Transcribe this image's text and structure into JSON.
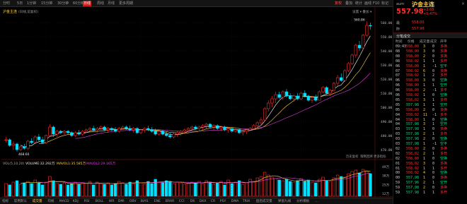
{
  "toolbar": {
    "periods": [
      "分时",
      "5日",
      "1分钟",
      "15分钟",
      "30分钟",
      "60分钟",
      "日线",
      "周线",
      "月线",
      "更多周期"
    ],
    "active_period": "日线",
    "right_items": [
      "复权",
      "叠加",
      "统计",
      "画线",
      "F10",
      "标记",
      "-",
      "⊡"
    ]
  },
  "chart_header": {
    "symbol": "沪金主连",
    "info": "(日线,前复权)",
    "setting": "设置 ▾ 叠加 ▾"
  },
  "chart_data": {
    "type": "candlestick",
    "ylim": [
      465,
      565
    ],
    "y_ticks": [
      560,
      550,
      540,
      530,
      520,
      510,
      500,
      490,
      480,
      470
    ],
    "x_labels": [
      {
        "i": 11,
        "label": "12"
      },
      {
        "i": 37,
        "label": "2024"
      },
      {
        "i": 62,
        "label": "02"
      },
      {
        "i": 81,
        "label": "03"
      },
      {
        "i": 102,
        "label": "04"
      }
    ],
    "high_label": "560.86",
    "low_label": "468.60",
    "ohlc": [
      [
        477,
        479,
        475,
        477
      ],
      [
        477,
        478,
        472,
        473
      ],
      [
        473,
        476,
        470,
        474
      ],
      [
        474,
        475,
        468.6,
        470
      ],
      [
        470,
        473,
        469,
        472
      ],
      [
        472,
        474,
        470,
        471
      ],
      [
        471,
        477,
        470,
        476
      ],
      [
        476,
        478,
        474,
        475
      ],
      [
        475,
        480,
        474,
        479
      ],
      [
        479,
        481,
        476,
        477
      ],
      [
        477,
        479,
        474,
        475
      ],
      [
        475,
        481,
        474,
        480
      ],
      [
        480,
        488,
        479,
        486
      ],
      [
        486,
        487,
        479,
        481
      ],
      [
        481,
        484,
        479,
        483
      ],
      [
        483,
        484,
        481,
        482
      ],
      [
        482,
        484,
        480,
        483
      ],
      [
        483,
        484,
        481,
        482
      ],
      [
        482,
        483,
        479,
        480
      ],
      [
        480,
        483,
        479,
        482
      ],
      [
        482,
        484,
        480,
        481
      ],
      [
        481,
        484,
        480,
        483
      ],
      [
        483,
        485,
        482,
        484
      ],
      [
        484,
        486,
        483,
        485
      ],
      [
        485,
        487,
        483,
        484
      ],
      [
        484,
        486,
        482,
        485
      ],
      [
        485,
        487,
        484,
        486
      ],
      [
        486,
        487,
        483,
        484
      ],
      [
        484,
        486,
        482,
        485
      ],
      [
        485,
        486,
        483,
        484
      ],
      [
        484,
        486,
        482,
        483
      ],
      [
        483,
        486,
        482,
        485
      ],
      [
        485,
        487,
        484,
        486
      ],
      [
        486,
        487,
        484,
        485
      ],
      [
        485,
        487,
        483,
        484
      ],
      [
        484,
        486,
        482,
        485
      ],
      [
        485,
        486,
        481,
        482
      ],
      [
        482,
        485,
        481,
        484
      ],
      [
        484,
        486,
        482,
        485
      ],
      [
        485,
        487,
        483,
        484
      ],
      [
        484,
        486,
        482,
        483
      ],
      [
        483,
        485,
        480,
        481
      ],
      [
        481,
        484,
        480,
        483
      ],
      [
        483,
        484,
        480,
        481
      ],
      [
        481,
        483,
        479,
        480
      ],
      [
        480,
        482,
        478,
        479
      ],
      [
        479,
        482,
        478,
        481
      ],
      [
        481,
        483,
        479,
        482
      ],
      [
        482,
        484,
        480,
        483
      ],
      [
        483,
        485,
        481,
        484
      ],
      [
        484,
        486,
        482,
        485
      ],
      [
        485,
        487,
        483,
        486
      ],
      [
        486,
        487,
        484,
        485
      ],
      [
        485,
        487,
        483,
        486
      ],
      [
        486,
        488,
        484,
        487
      ],
      [
        487,
        489,
        485,
        488
      ],
      [
        488,
        489,
        485,
        486
      ],
      [
        486,
        488,
        484,
        487
      ],
      [
        487,
        488,
        484,
        485
      ],
      [
        485,
        487,
        483,
        486
      ],
      [
        486,
        487,
        483,
        484
      ],
      [
        484,
        486,
        482,
        485
      ],
      [
        485,
        486,
        482,
        483
      ],
      [
        483,
        485,
        482,
        484
      ],
      [
        484,
        485,
        481,
        482
      ],
      [
        482,
        484,
        480,
        483
      ],
      [
        483,
        485,
        481,
        484
      ],
      [
        484,
        486,
        483,
        485
      ],
      [
        485,
        488,
        484,
        487
      ],
      [
        487,
        490,
        485,
        489
      ],
      [
        489,
        493,
        487,
        491
      ],
      [
        491,
        500,
        490,
        499
      ],
      [
        499,
        505,
        497,
        503
      ],
      [
        503,
        508,
        500,
        506
      ],
      [
        506,
        511,
        503,
        509
      ],
      [
        509,
        511,
        506,
        507
      ],
      [
        507,
        512,
        505,
        511
      ],
      [
        511,
        513,
        507,
        508
      ],
      [
        508,
        510,
        505,
        506
      ],
      [
        506,
        509,
        504,
        508
      ],
      [
        508,
        510,
        505,
        506
      ],
      [
        506,
        511,
        505,
        510
      ],
      [
        510,
        512,
        507,
        508
      ],
      [
        508,
        509,
        504,
        505
      ],
      [
        505,
        508,
        503,
        507
      ],
      [
        507,
        509,
        504,
        505
      ],
      [
        505,
        512,
        505,
        511
      ],
      [
        511,
        515,
        510,
        514
      ],
      [
        514,
        515,
        509,
        510
      ],
      [
        510,
        513,
        508,
        512
      ],
      [
        512,
        518,
        511,
        517
      ],
      [
        517,
        523,
        515,
        521
      ],
      [
        521,
        524,
        518,
        519
      ],
      [
        519,
        527,
        518,
        526
      ],
      [
        526,
        532,
        525,
        531
      ],
      [
        531,
        538,
        530,
        537
      ],
      [
        537,
        545,
        535,
        544
      ],
      [
        544,
        547,
        540,
        542
      ],
      [
        542,
        552,
        541,
        551
      ],
      [
        551,
        560.86,
        550,
        558
      ],
      [
        558,
        560,
        555,
        557.98
      ]
    ],
    "volume_legend": {
      "vol": "VOL(5,10,20)",
      "volume": "VOLUME:32.292万",
      "ma5": "MAVOL1:35.585万",
      "ma10": "MAVOL2:29.165万"
    },
    "volume": [
      18,
      16,
      20,
      22,
      17,
      19,
      21,
      18,
      23,
      19,
      16,
      20,
      28,
      22,
      18,
      17,
      19,
      16,
      18,
      20,
      17,
      19,
      18,
      21,
      16,
      20,
      18,
      17,
      19,
      16,
      18,
      21,
      19,
      17,
      20,
      18,
      22,
      19,
      17,
      21,
      18,
      24,
      20,
      19,
      22,
      21,
      18,
      20,
      19,
      17,
      18,
      20,
      19,
      21,
      18,
      22,
      20,
      17,
      19,
      21,
      16,
      23,
      18,
      20,
      22,
      17,
      19,
      24,
      21,
      26,
      28,
      34,
      30,
      27,
      25,
      23,
      22,
      24,
      21,
      20,
      22,
      25,
      21,
      23,
      20,
      19,
      24,
      27,
      22,
      21,
      26,
      30,
      28,
      27,
      32,
      35,
      37,
      33,
      38,
      36,
      32
    ],
    "volume_ylim": [
      0,
      42
    ],
    "vol_right_ticks": [
      "49万",
      "38万",
      "25万",
      "12万"
    ]
  },
  "price_axis_labels": [
    "560.00",
    "550.00",
    "540.00",
    "530.00",
    "520.00",
    "510.00",
    "500.00",
    "490.00",
    "480.00",
    "470.00"
  ],
  "overlay_labels": {
    "ajust": "历史复权",
    "day_restore": "策略回溯",
    "indicator": "更多指标"
  },
  "right_panel": {
    "contract": "aum",
    "name": "沪金主连",
    "price": "557.98",
    "change": "+2.68",
    "change_pct": "+0.47%",
    "last_label": "最",
    "last_value": "558.00",
    "prev_label": "昨",
    "prev_value": "557.96",
    "section_title": "分笔成交",
    "trade_headers": [
      "时间",
      "价格",
      "成交量",
      "成交",
      "开平"
    ],
    "trades": [
      {
        "t": "09:43",
        "p": "558.00",
        "v": "3",
        "o": "0",
        "k": "多换"
      },
      {
        "t": "08",
        "p": "558.00",
        "v": "3",
        "o": "0",
        "k": "多换"
      },
      {
        "t": "08",
        "p": "558.00",
        "v": "2",
        "o": "0",
        "k": "多换"
      },
      {
        "t": "08",
        "p": "558.02",
        "v": "1",
        "o": "1",
        "k": "多开"
      },
      {
        "t": "06",
        "p": "558.00",
        "v": "1",
        "o": "-1",
        "k": "空平"
      },
      {
        "t": "07",
        "p": "558.02",
        "v": "6",
        "o": "0",
        "k": "多换"
      },
      {
        "t": "07",
        "p": "558.02",
        "v": "1",
        "o": "2",
        "k": "多开"
      },
      {
        "t": "06",
        "p": "558.00",
        "v": "3",
        "o": "0",
        "k": "空换"
      },
      {
        "t": "06",
        "p": "558.00",
        "v": "1",
        "o": "1",
        "k": "空开"
      },
      {
        "t": "06",
        "p": "558.00",
        "v": "2",
        "o": "-1",
        "k": "多平"
      },
      {
        "t": "06",
        "p": "558.02",
        "v": "1",
        "o": "0",
        "k": "空换"
      },
      {
        "t": "05",
        "p": "558.02",
        "v": "3",
        "o": "1",
        "k": "多开"
      },
      {
        "t": "05",
        "p": "557.98",
        "v": "1",
        "o": "1",
        "k": "空开"
      },
      {
        "t": "05",
        "p": "558.00",
        "v": "2",
        "o": "0",
        "k": "多换"
      },
      {
        "t": "04",
        "p": "558.02",
        "v": "11",
        "o": "-1",
        "k": "多平"
      },
      {
        "t": "04",
        "p": "558.00",
        "v": "1",
        "o": "0",
        "k": "空换"
      },
      {
        "t": "04",
        "p": "557.98",
        "v": "3",
        "o": "1",
        "k": "空开"
      },
      {
        "t": "03",
        "p": "557.98",
        "v": "1",
        "o": "0",
        "k": "多换"
      },
      {
        "t": "03",
        "p": "557.98",
        "v": "2",
        "o": "1",
        "k": "多开"
      },
      {
        "t": "03",
        "p": "557.98",
        "v": "2",
        "o": "0",
        "k": "空换"
      },
      {
        "t": "03",
        "p": "557.98",
        "v": "1",
        "o": "-1",
        "k": "空平"
      },
      {
        "t": "02",
        "p": "558.00",
        "v": "2",
        "o": "0",
        "k": "多换"
      },
      {
        "t": "02",
        "p": "558.02",
        "v": "2",
        "o": "1",
        "k": "多开"
      },
      {
        "t": "02",
        "p": "558.00",
        "v": "1",
        "o": "0",
        "k": "空换"
      },
      {
        "t": "01",
        "p": "558.02",
        "v": "3",
        "o": "0",
        "k": "多换"
      },
      {
        "t": "01",
        "p": "558.02",
        "v": "1",
        "o": "1",
        "k": "多开"
      },
      {
        "t": "00",
        "p": "558.02",
        "v": "4",
        "o": "0",
        "k": "空换"
      },
      {
        "t": "00",
        "p": "557.98",
        "v": "1",
        "o": "0",
        "k": "多换"
      },
      {
        "t": "59",
        "p": "557.96",
        "v": "2",
        "o": "1",
        "k": "空开"
      },
      {
        "t": "59",
        "p": "557.98",
        "v": "2",
        "o": "0",
        "k": "多换"
      },
      {
        "t": "59",
        "p": "557.98",
        "v": "1",
        "o": "1",
        "k": "多开"
      }
    ]
  },
  "bottom_bar": {
    "items": [
      "指标",
      "常用默认",
      "成交量",
      "均线",
      "MACD",
      "KDJ",
      "RSI",
      "BOLL",
      "WR",
      "DMI",
      "OBV",
      "BIAS",
      "ENE",
      "BRAR",
      "CCI",
      "DK",
      "DKX",
      "CR",
      "PSY",
      "DMA",
      "TRIX",
      "盘后成交量",
      "弹窗九线",
      "分析模板",
      "…"
    ],
    "active": "成交量"
  },
  "colors": {
    "up": "#ff3030",
    "down": "#00e0ff",
    "ma5": "#ffffff",
    "ma10": "#ffd24a",
    "ma20": "#e040e0",
    "grid": "#3a0e0e",
    "axis_text": "#b0b0b0",
    "accent": "#c81e1e"
  }
}
